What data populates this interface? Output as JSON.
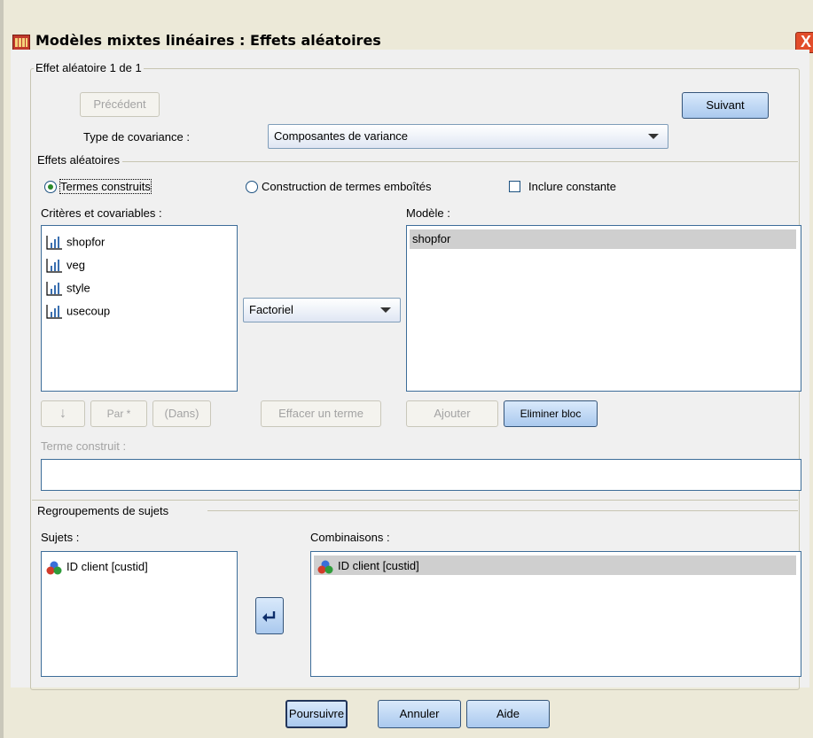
{
  "window": {
    "title": "Modèles mixtes linéaires : Effets aléatoires",
    "close_icon": "X"
  },
  "random_effect": {
    "group_label": "Effet aléatoire 1 de 1",
    "previous_label": "Précédent",
    "next_label": "Suivant",
    "covariance_label": "Type de covariance :",
    "covariance_value": "Composantes de variance"
  },
  "random_effects": {
    "group_label": "Effets aléatoires",
    "radio_build_terms": "Termes construits",
    "radio_nested_terms": "Construction de termes emboîtés",
    "include_intercept": "Inclure constante",
    "factors_label": "Critères et covariables :",
    "variables": [
      "shopfor",
      "veg",
      "style",
      "usecoup"
    ],
    "model_label": "Modèle :",
    "model_items": [
      "shopfor"
    ],
    "build_type": "Factoriel",
    "down_arrow_label": "↓",
    "by_label": "Par *",
    "within_label": "(Dans)",
    "clear_term_label": "Effacer un terme",
    "add_label": "Ajouter",
    "remove_label": "Eliminer bloc",
    "built_term_label": "Terme construit :",
    "built_term_value": ""
  },
  "subject_groupings": {
    "group_label": "Regroupements de sujets",
    "subjects_label": "Sujets :",
    "subjects": [
      "ID client [custid]"
    ],
    "combinations_label": "Combinaisons :",
    "combinations": [
      "ID client [custid]"
    ]
  },
  "footer": {
    "continue_label": "Poursuivre",
    "cancel_label": "Annuler",
    "help_label": "Aide"
  }
}
